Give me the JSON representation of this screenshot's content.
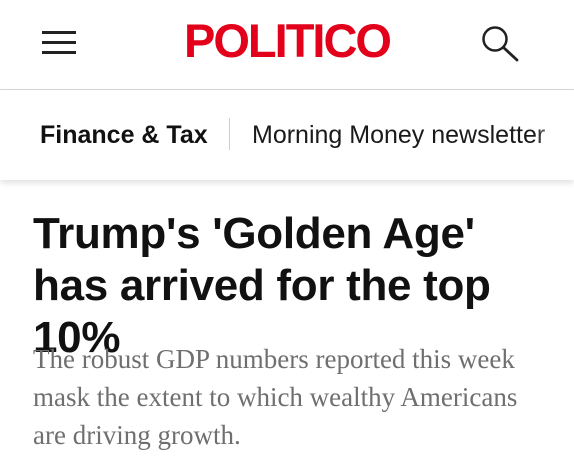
{
  "header": {
    "logo_text": "POLITICO",
    "logo_color": "#e2001a",
    "menu_icon": "hamburger-menu-icon",
    "search_icon": "search-icon"
  },
  "nav": {
    "section": "Finance & Tax",
    "link": "Morning Money newsletter"
  },
  "article": {
    "headline": "Trump's 'Golden Age' has arrived for the top 10%",
    "dek": "The robust GDP numbers reported this week mask the extent to which wealthy Americans are driving growth."
  }
}
